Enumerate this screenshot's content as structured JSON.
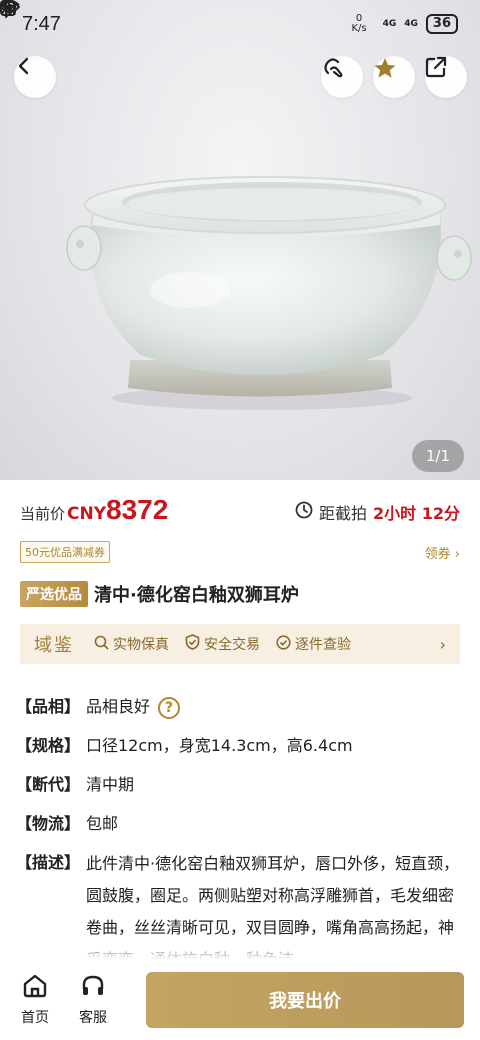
{
  "status_bar": {
    "time": "7:47",
    "net_speed_value": "0",
    "net_speed_unit": "K/s",
    "signal1": "4G",
    "signal2": "4G",
    "battery": "36"
  },
  "hero": {
    "counter": "1/1"
  },
  "price": {
    "label": "当前价",
    "currency": "CNY",
    "value": "8372"
  },
  "deadline": {
    "label": "距截拍",
    "remaining": "2小时 12分"
  },
  "coupon": {
    "badge": "50元优品满减券",
    "link": "领券"
  },
  "title": {
    "tag": "严选优品",
    "text": "清中·德化窑白釉双狮耳炉"
  },
  "assurance": {
    "brand": "域鉴",
    "items": [
      {
        "label": "实物保真",
        "icon": "search-icon"
      },
      {
        "label": "安全交易",
        "icon": "shield-check-icon"
      },
      {
        "label": "逐件查验",
        "icon": "check-circle-icon"
      }
    ]
  },
  "attributes": [
    {
      "key": "【品相】",
      "value": "品相良好",
      "help": "?"
    },
    {
      "key": "【规格】",
      "value": "口径12cm，身宽14.3cm，高6.4cm"
    },
    {
      "key": "【断代】",
      "value": "清中期"
    },
    {
      "key": "【物流】",
      "value": "包邮"
    },
    {
      "key": "【描述】",
      "value": "此件清中·德化窑白釉双狮耳炉，唇口外侈，短直颈，圆鼓腹，圈足。两侧贴塑对称高浮雕狮首，毛发细密卷曲，丝丝清晰可见，双目圆睁，嘴角高高扬起，神采奕奕。通体施白釉，釉色洁"
    }
  ],
  "bottom": {
    "home": "首页",
    "service": "客服",
    "bid": "我要出价"
  },
  "colors": {
    "accent_red": "#c8161d",
    "gold": "#b8985a",
    "assure_bg": "#f6efe2"
  }
}
